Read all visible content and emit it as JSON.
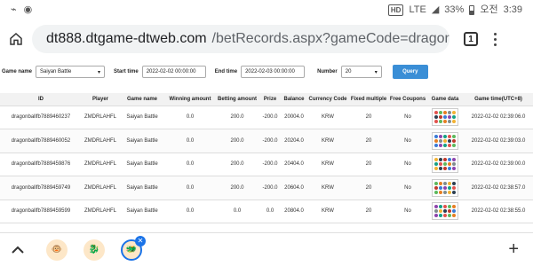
{
  "status": {
    "time": "3:39",
    "ampm": "오전",
    "battery": "33%",
    "lte": "LTE",
    "hd": "HD"
  },
  "browser": {
    "url_host": "dt888.dtgame-dtweb.com",
    "url_path": "/betRecords.aspx?gameCode=dragonball",
    "tab_count": "1"
  },
  "filters": {
    "game_name_label": "Game name",
    "game_name_value": "Saiyan Battle",
    "start_time_label": "Start time",
    "start_time_value": "2022-02-02 00:00:00",
    "end_time_label": "End time",
    "end_time_value": "2022-02-03 00:00:00",
    "number_label": "Number",
    "number_value": "20",
    "query_label": "Query"
  },
  "table": {
    "headers": [
      "ID",
      "Player",
      "Game name",
      "Winning amount",
      "Betting amount",
      "Prize",
      "Balance",
      "Currency Code",
      "Fixed multiple",
      "Free Coupons",
      "Game data",
      "Game time(UTC+8)"
    ],
    "rows": [
      [
        "dragonballfb7889460237",
        "ZMDRLAHFL",
        "Saiyan Battle",
        "0.0",
        "200.0",
        "-200.0",
        "20004.0",
        "KRW",
        "20",
        "No",
        "",
        "2022-02-02 02:39:06.0"
      ],
      [
        "dragonballfb7889460052",
        "ZMDRLAHFL",
        "Saiyan Battle",
        "0.0",
        "200.0",
        "-200.0",
        "20204.0",
        "KRW",
        "20",
        "No",
        "",
        "2022-02-02 02:39:03.0"
      ],
      [
        "dragonballfb7889459876",
        "ZMDRLAHFL",
        "Saiyan Battle",
        "0.0",
        "200.0",
        "-200.0",
        "20404.0",
        "KRW",
        "20",
        "No",
        "",
        "2022-02-02 02:39:00.0"
      ],
      [
        "dragonballfb7889459749",
        "ZMDRLAHFL",
        "Saiyan Battle",
        "0.0",
        "200.0",
        "-200.0",
        "20604.0",
        "KRW",
        "20",
        "No",
        "",
        "2022-02-02 02:38:57.0"
      ],
      [
        "dragonballfb7889459599",
        "ZMDRLAHFL",
        "Saiyan Battle",
        "0.0",
        "0.0",
        "0.0",
        "20804.0",
        "KRW",
        "20",
        "No",
        "",
        "2022-02-02 02:38:55.0"
      ]
    ]
  },
  "colors": {
    "query_button": "#3a8ed6",
    "tab_highlight": "#1a73e8"
  },
  "icons": [
    "home-icon",
    "lock-icon",
    "tab-count-icon",
    "more-vert-icon",
    "chevron-up-icon",
    "plus-icon",
    "close-icon"
  ]
}
